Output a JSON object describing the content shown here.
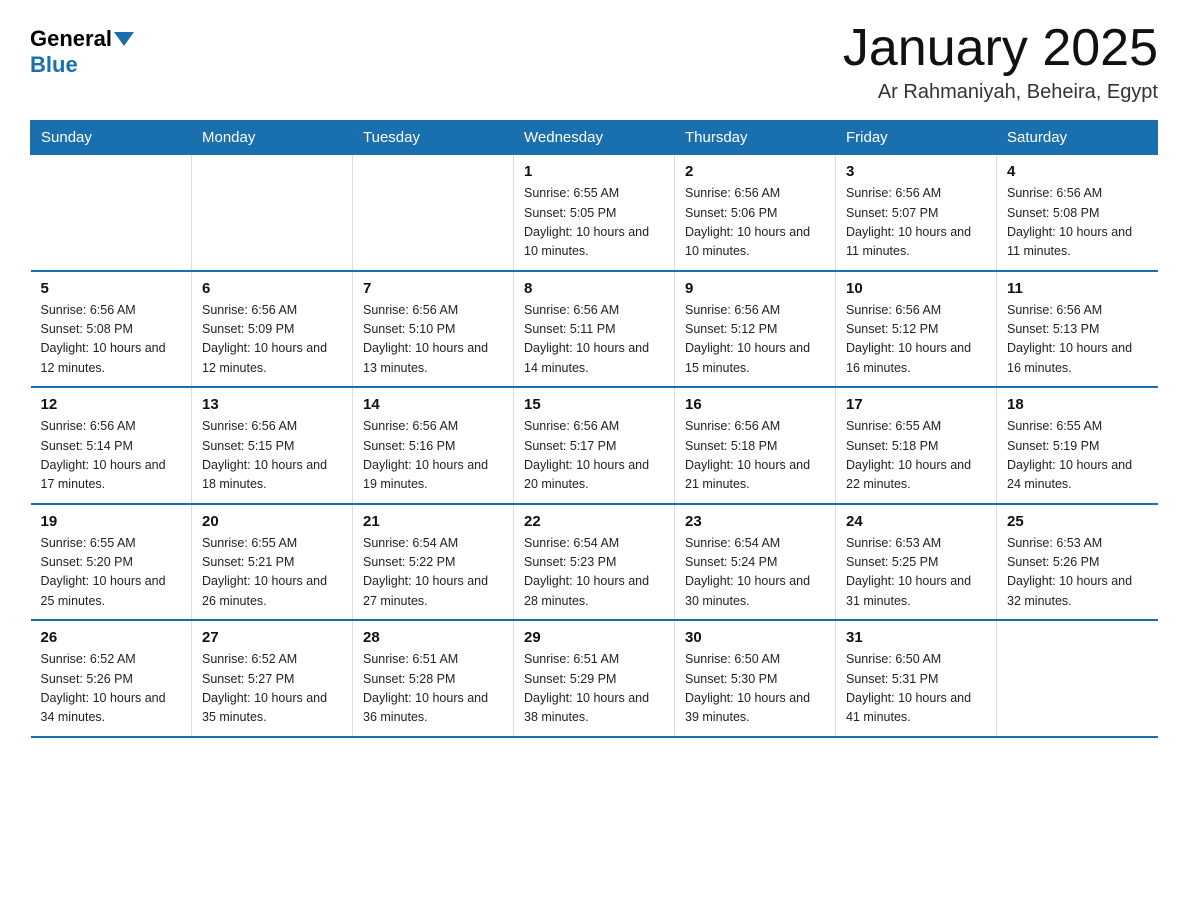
{
  "header": {
    "logo_general": "General",
    "logo_blue": "Blue",
    "title": "January 2025",
    "subtitle": "Ar Rahmaniyah, Beheira, Egypt"
  },
  "weekdays": [
    "Sunday",
    "Monday",
    "Tuesday",
    "Wednesday",
    "Thursday",
    "Friday",
    "Saturday"
  ],
  "weeks": [
    [
      {
        "day": "",
        "info": ""
      },
      {
        "day": "",
        "info": ""
      },
      {
        "day": "",
        "info": ""
      },
      {
        "day": "1",
        "info": "Sunrise: 6:55 AM\nSunset: 5:05 PM\nDaylight: 10 hours\nand 10 minutes."
      },
      {
        "day": "2",
        "info": "Sunrise: 6:56 AM\nSunset: 5:06 PM\nDaylight: 10 hours\nand 10 minutes."
      },
      {
        "day": "3",
        "info": "Sunrise: 6:56 AM\nSunset: 5:07 PM\nDaylight: 10 hours\nand 11 minutes."
      },
      {
        "day": "4",
        "info": "Sunrise: 6:56 AM\nSunset: 5:08 PM\nDaylight: 10 hours\nand 11 minutes."
      }
    ],
    [
      {
        "day": "5",
        "info": "Sunrise: 6:56 AM\nSunset: 5:08 PM\nDaylight: 10 hours\nand 12 minutes."
      },
      {
        "day": "6",
        "info": "Sunrise: 6:56 AM\nSunset: 5:09 PM\nDaylight: 10 hours\nand 12 minutes."
      },
      {
        "day": "7",
        "info": "Sunrise: 6:56 AM\nSunset: 5:10 PM\nDaylight: 10 hours\nand 13 minutes."
      },
      {
        "day": "8",
        "info": "Sunrise: 6:56 AM\nSunset: 5:11 PM\nDaylight: 10 hours\nand 14 minutes."
      },
      {
        "day": "9",
        "info": "Sunrise: 6:56 AM\nSunset: 5:12 PM\nDaylight: 10 hours\nand 15 minutes."
      },
      {
        "day": "10",
        "info": "Sunrise: 6:56 AM\nSunset: 5:12 PM\nDaylight: 10 hours\nand 16 minutes."
      },
      {
        "day": "11",
        "info": "Sunrise: 6:56 AM\nSunset: 5:13 PM\nDaylight: 10 hours\nand 16 minutes."
      }
    ],
    [
      {
        "day": "12",
        "info": "Sunrise: 6:56 AM\nSunset: 5:14 PM\nDaylight: 10 hours\nand 17 minutes."
      },
      {
        "day": "13",
        "info": "Sunrise: 6:56 AM\nSunset: 5:15 PM\nDaylight: 10 hours\nand 18 minutes."
      },
      {
        "day": "14",
        "info": "Sunrise: 6:56 AM\nSunset: 5:16 PM\nDaylight: 10 hours\nand 19 minutes."
      },
      {
        "day": "15",
        "info": "Sunrise: 6:56 AM\nSunset: 5:17 PM\nDaylight: 10 hours\nand 20 minutes."
      },
      {
        "day": "16",
        "info": "Sunrise: 6:56 AM\nSunset: 5:18 PM\nDaylight: 10 hours\nand 21 minutes."
      },
      {
        "day": "17",
        "info": "Sunrise: 6:55 AM\nSunset: 5:18 PM\nDaylight: 10 hours\nand 22 minutes."
      },
      {
        "day": "18",
        "info": "Sunrise: 6:55 AM\nSunset: 5:19 PM\nDaylight: 10 hours\nand 24 minutes."
      }
    ],
    [
      {
        "day": "19",
        "info": "Sunrise: 6:55 AM\nSunset: 5:20 PM\nDaylight: 10 hours\nand 25 minutes."
      },
      {
        "day": "20",
        "info": "Sunrise: 6:55 AM\nSunset: 5:21 PM\nDaylight: 10 hours\nand 26 minutes."
      },
      {
        "day": "21",
        "info": "Sunrise: 6:54 AM\nSunset: 5:22 PM\nDaylight: 10 hours\nand 27 minutes."
      },
      {
        "day": "22",
        "info": "Sunrise: 6:54 AM\nSunset: 5:23 PM\nDaylight: 10 hours\nand 28 minutes."
      },
      {
        "day": "23",
        "info": "Sunrise: 6:54 AM\nSunset: 5:24 PM\nDaylight: 10 hours\nand 30 minutes."
      },
      {
        "day": "24",
        "info": "Sunrise: 6:53 AM\nSunset: 5:25 PM\nDaylight: 10 hours\nand 31 minutes."
      },
      {
        "day": "25",
        "info": "Sunrise: 6:53 AM\nSunset: 5:26 PM\nDaylight: 10 hours\nand 32 minutes."
      }
    ],
    [
      {
        "day": "26",
        "info": "Sunrise: 6:52 AM\nSunset: 5:26 PM\nDaylight: 10 hours\nand 34 minutes."
      },
      {
        "day": "27",
        "info": "Sunrise: 6:52 AM\nSunset: 5:27 PM\nDaylight: 10 hours\nand 35 minutes."
      },
      {
        "day": "28",
        "info": "Sunrise: 6:51 AM\nSunset: 5:28 PM\nDaylight: 10 hours\nand 36 minutes."
      },
      {
        "day": "29",
        "info": "Sunrise: 6:51 AM\nSunset: 5:29 PM\nDaylight: 10 hours\nand 38 minutes."
      },
      {
        "day": "30",
        "info": "Sunrise: 6:50 AM\nSunset: 5:30 PM\nDaylight: 10 hours\nand 39 minutes."
      },
      {
        "day": "31",
        "info": "Sunrise: 6:50 AM\nSunset: 5:31 PM\nDaylight: 10 hours\nand 41 minutes."
      },
      {
        "day": "",
        "info": ""
      }
    ]
  ]
}
